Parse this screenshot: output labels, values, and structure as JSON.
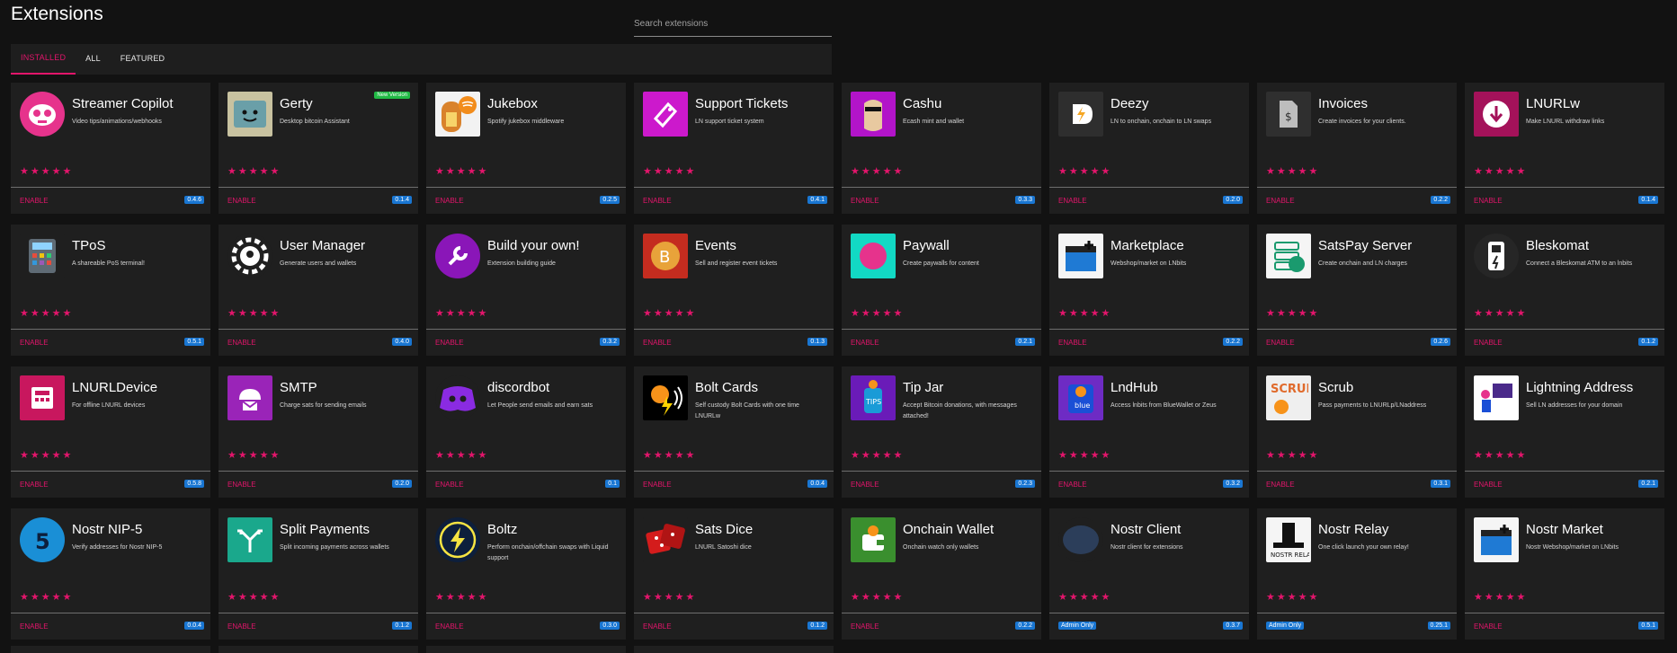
{
  "page_title": "Extensions",
  "search": {
    "placeholder": "Search extensions"
  },
  "tabs": [
    "INSTALLED",
    "ALL",
    "FEATURED"
  ],
  "active_tab": "INSTALLED",
  "colors": {
    "accent": "#e2156b",
    "version_badge": "#1976d2",
    "new_badge": "#21ba45",
    "card_bg": "#1f1f1f",
    "page_bg": "#121212"
  },
  "stars_label": "★★★★★",
  "enable_label": "ENABLE",
  "admin_only_label": "Admin Only",
  "extensions": [
    {
      "name": "Streamer Copilot",
      "desc": "Video tips/animations/webhooks",
      "version": "0.4.6",
      "icon": "streamer-copilot-icon",
      "icon_bg": "#e6338c"
    },
    {
      "name": "Gerty",
      "desc": "Desktop bitcoin Assistant",
      "version": "0.1.4",
      "icon": "gerty-icon",
      "icon_bg": "#c8c2a0",
      "badge": "New Version"
    },
    {
      "name": "Jukebox",
      "desc": "Spotify jukebox middleware",
      "version": "0.2.5",
      "icon": "jukebox-icon",
      "icon_bg": "#f2f2f2"
    },
    {
      "name": "Support Tickets",
      "desc": "LN support ticket system",
      "version": "0.4.1",
      "icon": "support-tickets-icon",
      "icon_bg": "#cc19cc"
    },
    {
      "name": "Cashu",
      "desc": "Ecash mint and wallet",
      "version": "0.3.3",
      "icon": "cashu-icon",
      "icon_bg": "#b214c9"
    },
    {
      "name": "Deezy",
      "desc": "LN to onchain, onchain to LN swaps",
      "version": "0.2.0",
      "icon": "deezy-icon",
      "icon_bg": "#2e2e2e"
    },
    {
      "name": "Invoices",
      "desc": "Create invoices for your clients.",
      "version": "0.2.2",
      "icon": "invoices-icon",
      "icon_bg": "#2f2f2f"
    },
    {
      "name": "LNURLw",
      "desc": "Make LNURL withdraw links",
      "version": "0.1.4",
      "icon": "lnurlw-icon",
      "icon_bg": "#a4125a"
    },
    {
      "name": "TPoS",
      "desc": "A shareable PoS terminal!",
      "version": "0.5.1",
      "icon": "tpos-icon",
      "icon_bg": "#1f1f1f"
    },
    {
      "name": "User Manager",
      "desc": "Generate users and wallets",
      "version": "0.4.0",
      "icon": "user-manager-icon",
      "icon_bg": "#1f1f1f"
    },
    {
      "name": "Build your own!",
      "desc": "Extension building guide",
      "version": "0.3.2",
      "icon": "build-your-own-icon",
      "icon_bg": "#8a16b8"
    },
    {
      "name": "Events",
      "desc": "Sell and register event tickets",
      "version": "0.1.3",
      "icon": "events-icon",
      "icon_bg": "#c42c1f"
    },
    {
      "name": "Paywall",
      "desc": "Create paywalls for content",
      "version": "0.2.1",
      "icon": "paywall-icon",
      "icon_bg": "#12d9c4"
    },
    {
      "name": "Marketplace",
      "desc": "Webshop/market on LNbits",
      "version": "0.2.2",
      "icon": "marketplace-icon",
      "icon_bg": "#f5f5f5"
    },
    {
      "name": "SatsPay Server",
      "desc": "Create onchain and LN charges",
      "version": "0.2.6",
      "icon": "satspay-server-icon",
      "icon_bg": "#f5f5f5"
    },
    {
      "name": "Bleskomat",
      "desc": "Connect a Bleskomat ATM to an lnbits",
      "version": "0.1.2",
      "icon": "bleskomat-icon",
      "icon_bg": "#262626"
    },
    {
      "name": "LNURLDevice",
      "desc": "For offline LNURL devices",
      "version": "0.5.8",
      "icon": "lnurldevice-icon",
      "icon_bg": "#c8175e"
    },
    {
      "name": "SMTP",
      "desc": "Charge sats for sending emails",
      "version": "0.2.0",
      "icon": "smtp-icon",
      "icon_bg": "#9a24b8"
    },
    {
      "name": "discordbot",
      "desc": "Let People send emails and earn sats",
      "version": "0.1",
      "icon": "discord-icon",
      "icon_bg": "#1f1f1f"
    },
    {
      "name": "Bolt Cards",
      "desc": "Self custody Bolt Cards with one time LNURLw",
      "version": "0.0.4",
      "icon": "bolt-cards-icon",
      "icon_bg": "#000000"
    },
    {
      "name": "Tip Jar",
      "desc": "Accept Bitcoin donations, with messages attached!",
      "version": "0.2.3",
      "icon": "tip-jar-icon",
      "icon_bg": "#6a1bb8"
    },
    {
      "name": "LndHub",
      "desc": "Access lnbits from BlueWallet or Zeus",
      "version": "0.3.2",
      "icon": "lndhub-icon",
      "icon_bg": "#6e2bc4"
    },
    {
      "name": "Scrub",
      "desc": "Pass payments to LNURLp/LNaddress",
      "version": "0.3.1",
      "icon": "scrub-icon",
      "icon_bg": "#efefef"
    },
    {
      "name": "Lightning Address",
      "desc": "Sell LN addresses for your domain",
      "version": "0.2.1",
      "icon": "lightning-address-icon",
      "icon_bg": "#ffffff"
    },
    {
      "name": "Nostr NIP-5",
      "desc": "Verify addresses for Nostr NIP-5",
      "version": "0.0.4",
      "icon": "nostr-nip5-icon",
      "icon_bg": "#1a8fd6"
    },
    {
      "name": "Split Payments",
      "desc": "Split incoming payments across wallets",
      "version": "0.1.2",
      "icon": "split-payments-icon",
      "icon_bg": "#1aa88c"
    },
    {
      "name": "Boltz",
      "desc": "Perform onchain/offchain swaps with Liquid support",
      "version": "0.3.0",
      "icon": "boltz-icon",
      "icon_bg": "#0d1f3c"
    },
    {
      "name": "Sats Dice",
      "desc": "LNURL Satoshi dice",
      "version": "0.1.2",
      "icon": "sats-dice-icon",
      "icon_bg": "#1f1f1f"
    },
    {
      "name": "Onchain Wallet",
      "desc": "Onchain watch only wallets",
      "version": "0.2.2",
      "icon": "onchain-wallet-icon",
      "icon_bg": "#3a8f2e"
    },
    {
      "name": "Nostr Client",
      "desc": "Nostr client for extensions",
      "version": "0.3.7",
      "icon": "nostr-client-icon",
      "icon_bg": "#1f1f1f",
      "admin": true
    },
    {
      "name": "Nostr Relay",
      "desc": "One click launch your own relay!",
      "version": "0.25.1",
      "icon": "nostr-relay-icon",
      "icon_bg": "#f5f5f5",
      "admin": true
    },
    {
      "name": "Nostr Market",
      "desc": "Nostr Webshop/market on LNbits",
      "version": "0.5.1",
      "icon": "nostr-market-icon",
      "icon_bg": "#f5f5f5"
    }
  ]
}
